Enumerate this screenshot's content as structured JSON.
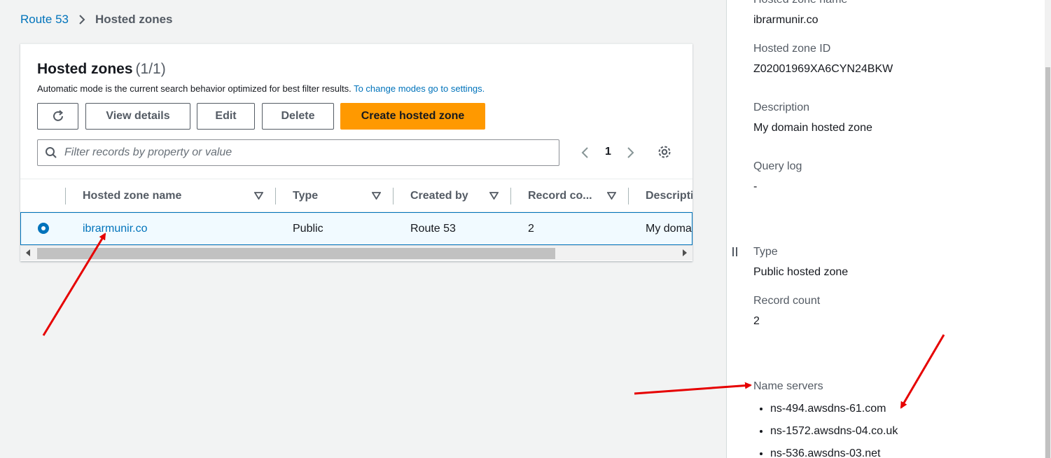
{
  "breadcrumb": {
    "parent": "Route 53",
    "current": "Hosted zones"
  },
  "panel": {
    "title": "Hosted zones",
    "count": "(1/1)",
    "description": "Automatic mode is the current search behavior optimized for best filter results.",
    "description_link": "To change modes go to settings."
  },
  "toolbar": {
    "refresh_icon": "refresh-icon",
    "view_details": "View details",
    "edit": "Edit",
    "delete": "Delete",
    "create": "Create hosted zone"
  },
  "search": {
    "placeholder": "Filter records by property or value"
  },
  "pagination": {
    "page": "1"
  },
  "table": {
    "columns": [
      "Hosted zone name",
      "Type",
      "Created by",
      "Record co...",
      "Descripti"
    ],
    "rows": [
      {
        "name": "ibrarmunir.co",
        "type": "Public",
        "created_by": "Route 53",
        "record_count": "2",
        "description": "My doma"
      }
    ]
  },
  "details": {
    "name_label": "Hosted zone name",
    "name_value": "ibrarmunir.co",
    "id_label": "Hosted zone ID",
    "id_value": "Z02001969XA6CYN24BKW",
    "description_label": "Description",
    "description_value": "My domain hosted zone",
    "query_log_label": "Query log",
    "query_log_value": "-",
    "type_label": "Type",
    "type_value": "Public hosted zone",
    "record_count_label": "Record count",
    "record_count_value": "2",
    "name_servers_label": "Name servers",
    "name_servers": [
      "ns-494.awsdns-61.com",
      "ns-1572.awsdns-04.co.uk",
      "ns-536.awsdns-03.net"
    ]
  },
  "colors": {
    "link": "#0073bb",
    "primary": "#ff9900",
    "annotation": "#e60000"
  }
}
